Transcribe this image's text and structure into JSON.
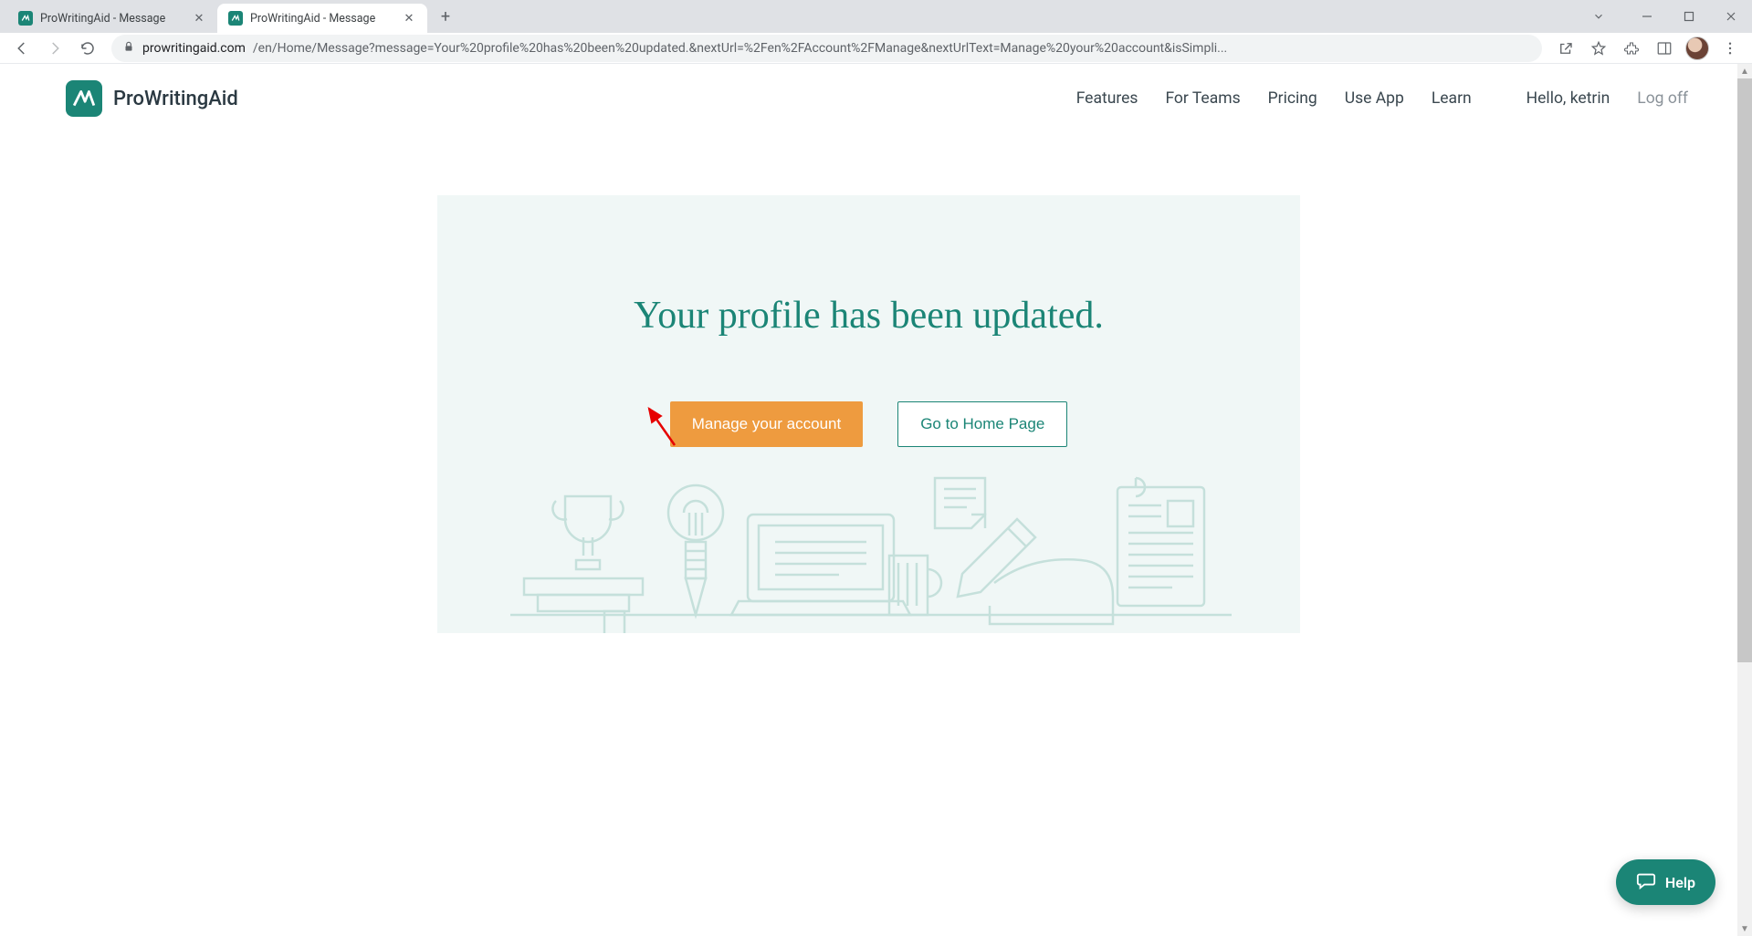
{
  "browser": {
    "tabs": [
      {
        "title": "ProWritingAid - Message"
      },
      {
        "title": "ProWritingAid - Message"
      }
    ],
    "url_host": "prowritingaid.com",
    "url_path": "/en/Home/Message?message=Your%20profile%20has%20been%20updated.&nextUrl=%2Fen%2FAccount%2FManage&nextUrlText=Manage%20your%20account&isSimpli..."
  },
  "brand": {
    "name": "ProWritingAid"
  },
  "nav": {
    "features": "Features",
    "for_teams": "For Teams",
    "pricing": "Pricing",
    "use_app": "Use App",
    "learn": "Learn",
    "greeting": "Hello, ketrin",
    "logoff": "Log off"
  },
  "hero": {
    "heading": "Your profile has been updated.",
    "primary_btn": "Manage your account",
    "secondary_btn": "Go to Home Page"
  },
  "help": {
    "label": "Help"
  },
  "colors": {
    "teal": "#1b8576",
    "orange": "#ee9b3f",
    "panel_bg": "#f0f7f6"
  }
}
